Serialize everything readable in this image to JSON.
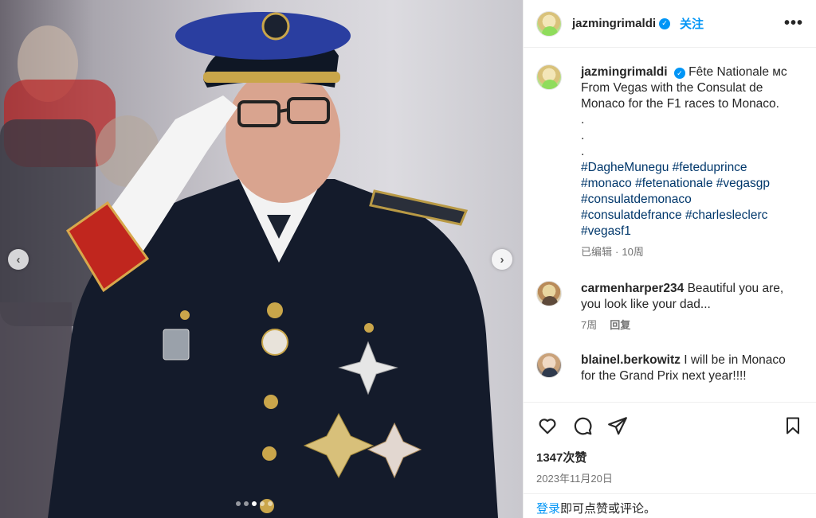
{
  "post": {
    "username": "jazmingrimaldi",
    "verified_mark": "✓",
    "follow_label": "关注",
    "more_label": "•••"
  },
  "photo": {
    "prev_label": "‹",
    "next_label": "›",
    "slide_count": 5,
    "active_slide": 2
  },
  "caption": {
    "username": "jazmingrimaldi",
    "lines": [
      "Fête Nationale ᴍᴄ",
      "From Vegas with the Consulat de Monaco for the F1 races to Monaco.",
      ".",
      ".",
      "."
    ],
    "hashtags": [
      "#DagheMunegu",
      "#feteduprince",
      "#monaco",
      "#fetenationale",
      "#vegasgp",
      "#consulatdemonaco",
      "#consulatdefrance",
      "#charlesleclerc",
      "#vegasf1"
    ],
    "edited_label": "已编辑",
    "separator": "·",
    "time": "10周"
  },
  "comments": [
    {
      "username": "carmenharper234",
      "text": "Beautiful you are, you look like your dad...",
      "time": "7周",
      "reply_label": "回复"
    },
    {
      "username": "blainel.berkowitz",
      "text": "I will be in Monaco for the Grand Prix next year!!!!",
      "time": "",
      "reply_label": ""
    }
  ],
  "actions": {
    "icons": [
      "heart-icon",
      "comment-icon",
      "share-icon",
      "bookmark-icon"
    ],
    "likes": "1347次赞",
    "date": "2023年11月20日"
  },
  "login": {
    "link_label": "登录",
    "suffix": "即可点赞或评论。"
  },
  "colors": {
    "accent": "#0095f6",
    "hashtag": "#00376b",
    "muted": "#737373",
    "text": "#262626"
  }
}
